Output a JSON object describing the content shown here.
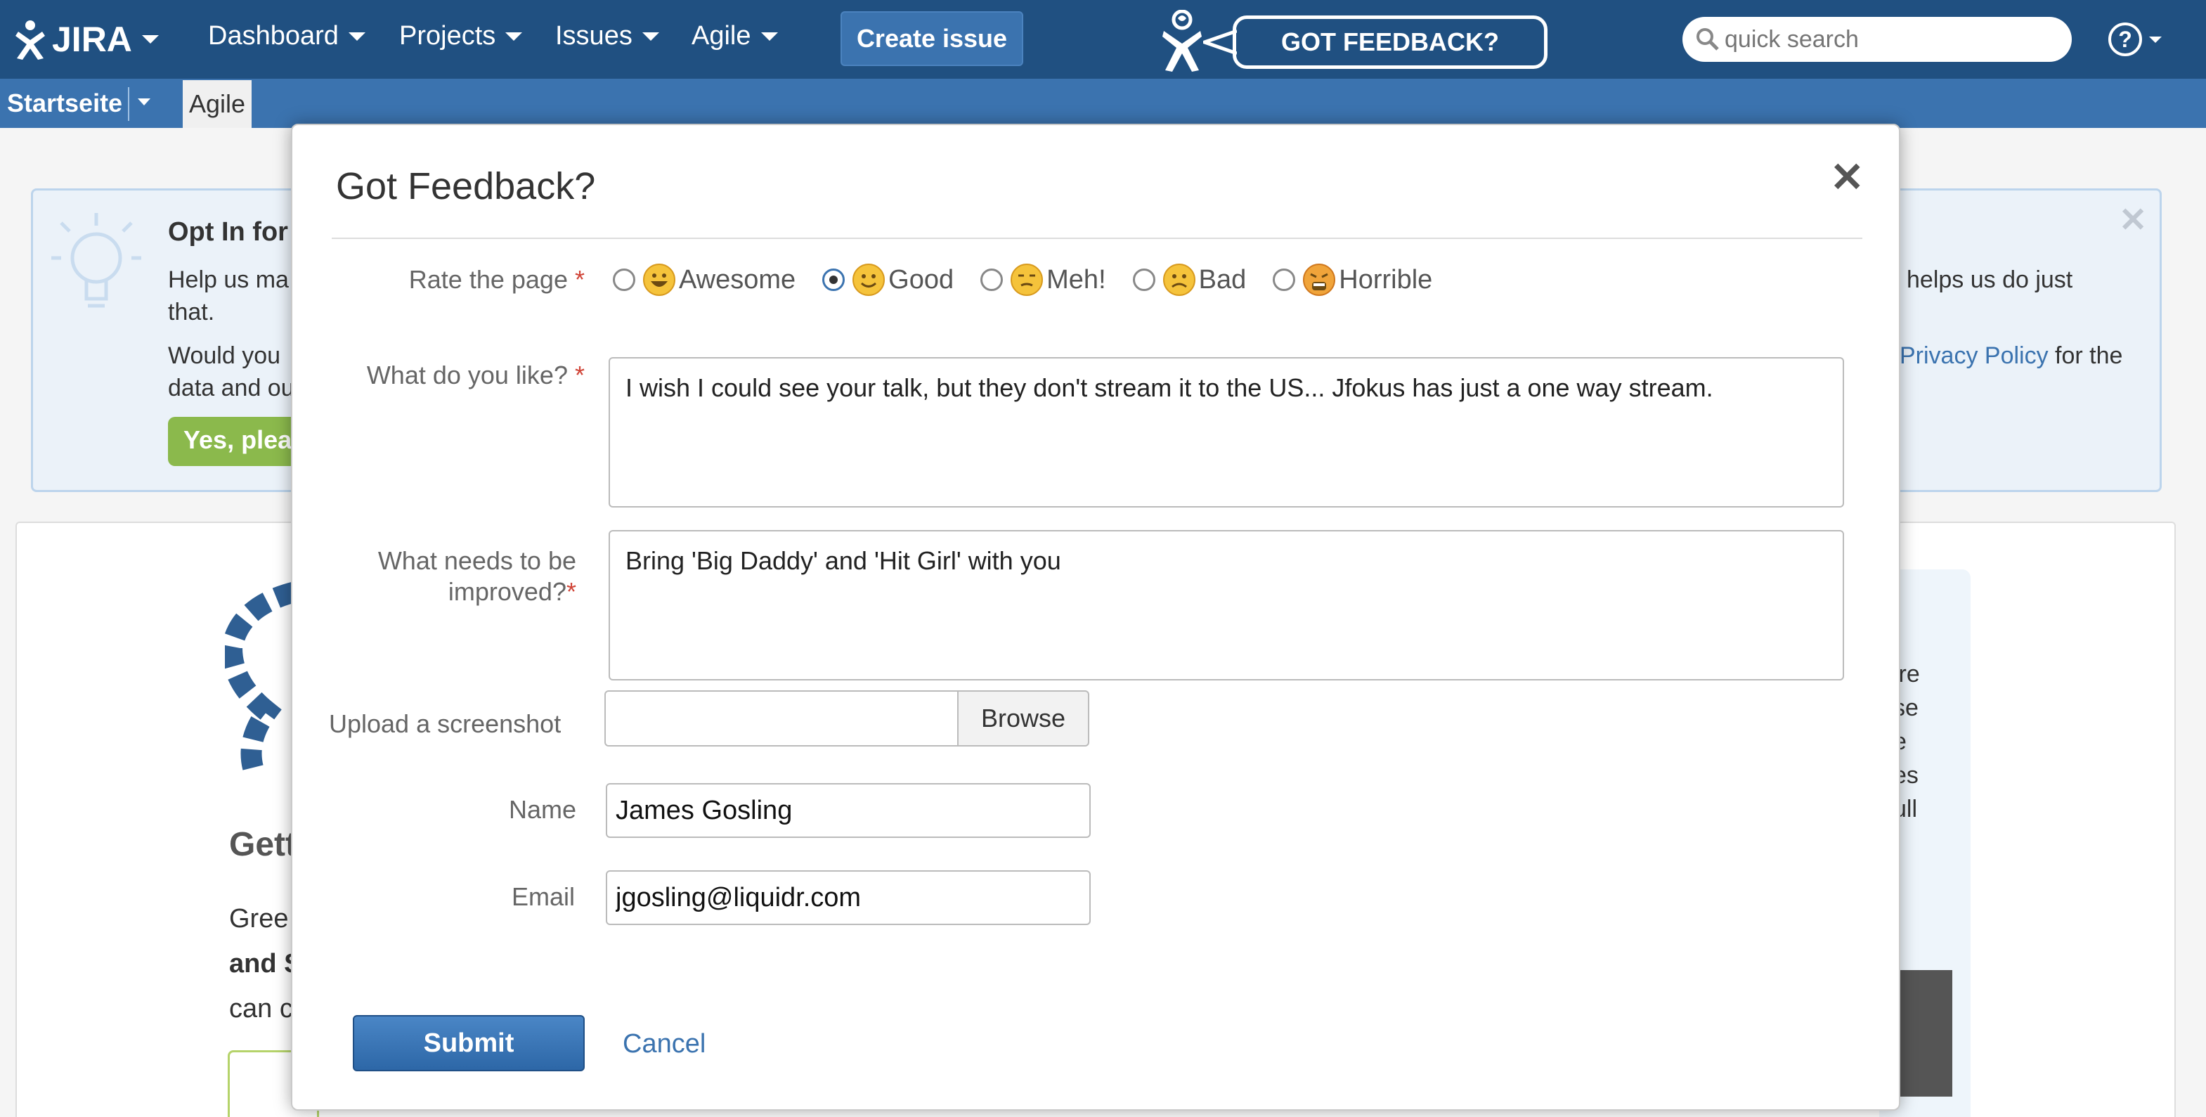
{
  "header": {
    "logo_text": "JIRA",
    "nav": [
      {
        "label": "Dashboard"
      },
      {
        "label": "Projects"
      },
      {
        "label": "Issues"
      },
      {
        "label": "Agile"
      }
    ],
    "create_issue_label": "Create issue",
    "feedback_label": "GOT FEEDBACK?",
    "search_placeholder": "quick search",
    "help_glyph": "?",
    "colors": {
      "header_bg": "#205081",
      "subnav_bg": "#3b73af"
    }
  },
  "subnav": {
    "startseite_label": "Startseite",
    "active_tab": "Agile"
  },
  "background": {
    "optin": {
      "title": "Opt In for",
      "text1_start": "Help us ma",
      "text1_wrap": "that.",
      "text1_end": "helps us do just",
      "text2_start": "Would you",
      "text2_wrap": "data and ou",
      "privacy_link": "Privacy Policy",
      "text2_end": " for the",
      "yes_button": "Yes, plea"
    },
    "card": {
      "heading": "Gett",
      "line1": "Gree",
      "line2": "and S",
      "line3": "can c",
      "right_fragments": [
        "ire",
        "se",
        "e",
        "es",
        "ull"
      ]
    }
  },
  "dialog": {
    "title": "Got Feedback?",
    "close_glyph": "✕",
    "rating": {
      "label": "Rate the page",
      "options": [
        {
          "label": "Awesome",
          "icon": "smiley-awesome-icon"
        },
        {
          "label": "Good",
          "icon": "smiley-good-icon"
        },
        {
          "label": "Meh!",
          "icon": "smiley-meh-icon"
        },
        {
          "label": "Bad",
          "icon": "smiley-bad-icon"
        },
        {
          "label": "Horrible",
          "icon": "smiley-horrible-icon"
        }
      ],
      "selected": "Good"
    },
    "like": {
      "label": "What do you like?",
      "value": "I wish I could see your talk, but they don't stream it to the US... Jfokus has just a one way stream."
    },
    "improve": {
      "label_line1": "What needs to be",
      "label_line2": "improved?",
      "value": "Bring 'Big Daddy' and 'Hit Girl' with you"
    },
    "upload": {
      "label": "Upload a screenshot",
      "browse_label": "Browse"
    },
    "name": {
      "label": "Name",
      "value": "James Gosling"
    },
    "email": {
      "label": "Email",
      "value": "jgosling@liquidr.com"
    },
    "required_mark": "*",
    "submit_label": "Submit",
    "cancel_label": "Cancel"
  }
}
